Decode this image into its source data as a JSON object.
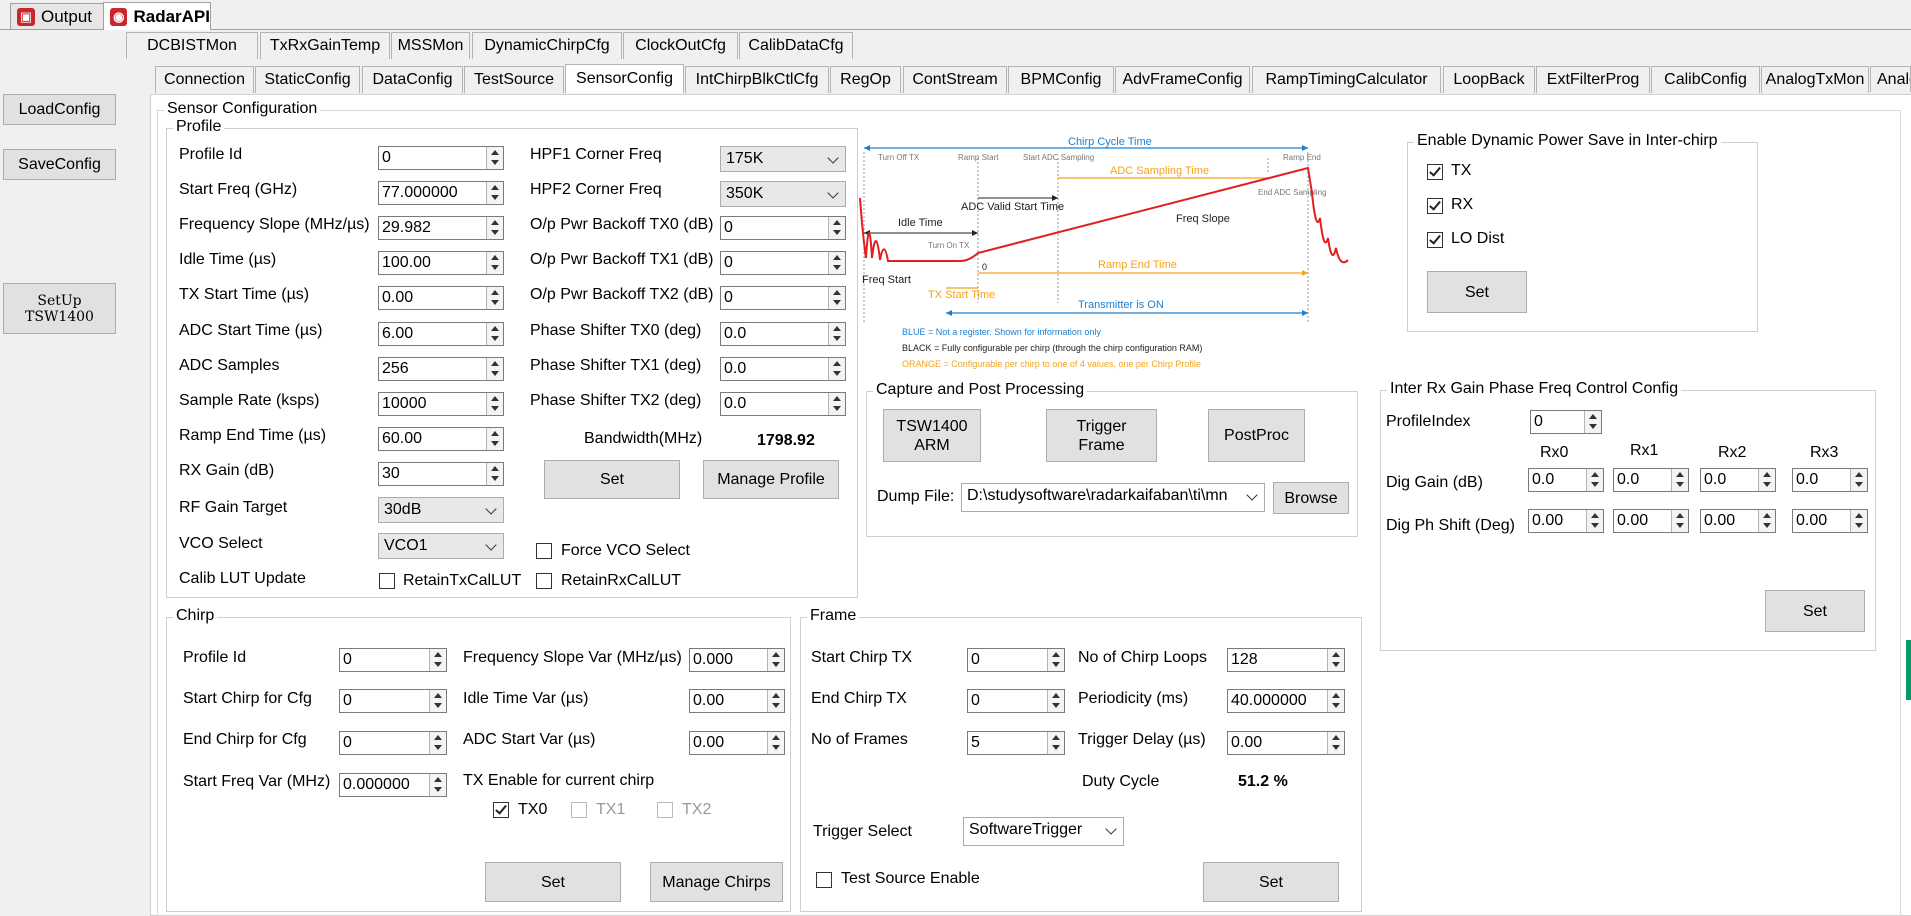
{
  "top_tabs": [
    {
      "label": "Output"
    },
    {
      "label": "RadarAPI"
    }
  ],
  "sub_tabs_row1": [
    "DCBISTMon",
    "TxRxGainTemp",
    "MSSMon",
    "DynamicChirpCfg",
    "ClockOutCfg",
    "CalibDataCfg"
  ],
  "sub_tabs_row2": [
    "Connection",
    "StaticConfig",
    "DataConfig",
    "TestSource",
    "SensorConfig",
    "IntChirpBlkCtlCfg",
    "RegOp",
    "ContStream",
    "BPMConfig",
    "AdvFrameConfig",
    "RampTimingCalculator",
    "LoopBack",
    "ExtFilterProg",
    "CalibConfig",
    "AnalogTxMon",
    "Analo"
  ],
  "side": {
    "load": "LoadConfig",
    "save": "SaveConfig",
    "setup": "SetUp\nTSW1400"
  },
  "sensor": {
    "title": "Sensor Configuration"
  },
  "profile": {
    "title": "Profile",
    "left": [
      {
        "label": "Profile Id",
        "value": "0"
      },
      {
        "label": "Start Freq (GHz)",
        "value": "77.000000"
      },
      {
        "label": "Frequency Slope (MHz/µs)",
        "value": "29.982"
      },
      {
        "label": "Idle Time (µs)",
        "value": "100.00"
      },
      {
        "label": "TX Start Time (µs)",
        "value": "0.00"
      },
      {
        "label": "ADC Start Time (µs)",
        "value": "6.00"
      },
      {
        "label": "ADC Samples",
        "value": "256"
      },
      {
        "label": "Sample Rate (ksps)",
        "value": "10000"
      },
      {
        "label": "Ramp End Time (µs)",
        "value": "60.00"
      },
      {
        "label": "RX Gain (dB)",
        "value": "30"
      }
    ],
    "rf_gain": {
      "label": "RF Gain Target",
      "value": "30dB"
    },
    "vco": {
      "label": "VCO Select",
      "value": "VCO1"
    },
    "calib_lut": {
      "label": "Calib LUT Update",
      "retain_tx": "RetainTxCalLUT",
      "retain_rx": "RetainRxCalLUT"
    },
    "hpf1": {
      "label": "HPF1 Corner Freq",
      "value": "175K"
    },
    "hpf2": {
      "label": "HPF2 Corner Freq",
      "value": "350K"
    },
    "right": [
      {
        "label": "O/p Pwr Backoff TX0 (dB)",
        "value": "0"
      },
      {
        "label": "O/p Pwr Backoff TX1 (dB)",
        "value": "0"
      },
      {
        "label": "O/p Pwr Backoff TX2 (dB)",
        "value": "0"
      },
      {
        "label": "Phase Shifter TX0 (deg)",
        "value": "0.0"
      },
      {
        "label": "Phase Shifter TX1 (deg)",
        "value": "0.0"
      },
      {
        "label": "Phase Shifter TX2 (deg)",
        "value": "0.0"
      }
    ],
    "bandwidth_label": "Bandwidth(MHz)",
    "bandwidth_value": "1798.92",
    "set": "Set",
    "manage": "Manage Profile",
    "force_vco": "Force VCO Select"
  },
  "diagram": {
    "chirp_cycle": "Chirp Cycle Time",
    "turn_off_tx": "Turn Off TX",
    "ramp_start": "Ramp Start",
    "start_adc": "Start ADC Sampling",
    "ramp_end": "Ramp End",
    "adc_sampling_time": "ADC Sampling Time",
    "end_adc": "End ADC\nSampling",
    "adc_valid": "ADC Valid Start Time",
    "idle_time": "Idle Time",
    "freq_slope": "Freq Slope",
    "turn_on_tx": "Turn On TX",
    "zero": "0",
    "ramp_end_time": "Ramp End Time",
    "freq_start": "Freq Start",
    "tx_start": "TX Start Time",
    "transmitter_on": "Transmitter is ON",
    "legend_blue": "BLUE = Not a register. Shown for information only",
    "legend_black": "BLACK = Fully configurable per chirp (through the chirp configuration RAM)",
    "legend_orange": "ORANGE = Configurable per chirp to one of 4 values, one per Chirp Profile"
  },
  "dynpower": {
    "title": "Enable Dynamic Power Save in Inter-chirp",
    "tx": "TX",
    "rx": "RX",
    "lo": "LO Dist",
    "set": "Set"
  },
  "capture": {
    "title": "Capture and Post Processing",
    "arm": "TSW1400\nARM",
    "trigger": "Trigger\nFrame",
    "postproc": "PostProc",
    "dump_label": "Dump File:",
    "dump_value": "D:\\studysoftware\\radarkaifaban\\ti\\mn",
    "browse": "Browse"
  },
  "interrx": {
    "title": "Inter Rx Gain Phase Freq Control Config",
    "profile_label": "ProfileIndex",
    "profile_value": "0",
    "cols": [
      "Rx0",
      "Rx1",
      "Rx2",
      "Rx3"
    ],
    "dig_gain_label": "Dig Gain (dB)",
    "dig_gain": [
      "0.0",
      "0.0",
      "0.0",
      "0.0"
    ],
    "dig_ph_label": "Dig Ph Shift (Deg)",
    "dig_ph": [
      "0.00",
      "0.00",
      "0.00",
      "0.00"
    ],
    "set": "Set"
  },
  "chirp": {
    "title": "Chirp",
    "left": [
      {
        "label": "Profile Id",
        "value": "0"
      },
      {
        "label": "Start Chirp for Cfg",
        "value": "0"
      },
      {
        "label": "End Chirp for Cfg",
        "value": "0"
      },
      {
        "label": "Start Freq Var (MHz)",
        "value": "0.000000"
      }
    ],
    "right": [
      {
        "label": "Frequency Slope Var (MHz/µs)",
        "value": "0.000"
      },
      {
        "label": "Idle Time Var (µs)",
        "value": "0.00"
      },
      {
        "label": "ADC Start Var (µs)",
        "value": "0.00"
      }
    ],
    "tx_enable": "TX Enable for current chirp",
    "tx0": "TX0",
    "tx1": "TX1",
    "tx2": "TX2",
    "set": "Set",
    "manage": "Manage Chirps"
  },
  "frame": {
    "title": "Frame",
    "left": [
      {
        "label": "Start Chirp TX",
        "value": "0"
      },
      {
        "label": "End Chirp TX",
        "value": "0"
      },
      {
        "label": "No of Frames",
        "value": "5"
      }
    ],
    "right": [
      {
        "label": "No of Chirp Loops",
        "value": "128"
      },
      {
        "label": "Periodicity (ms)",
        "value": "40.000000"
      },
      {
        "label": "Trigger Delay (µs)",
        "value": "0.00"
      }
    ],
    "duty_label": "Duty Cycle",
    "duty_value": "51.2 %",
    "trigger_label": "Trigger Select",
    "trigger_value": "SoftwareTrigger",
    "test_source": "Test Source Enable",
    "set": "Set"
  }
}
